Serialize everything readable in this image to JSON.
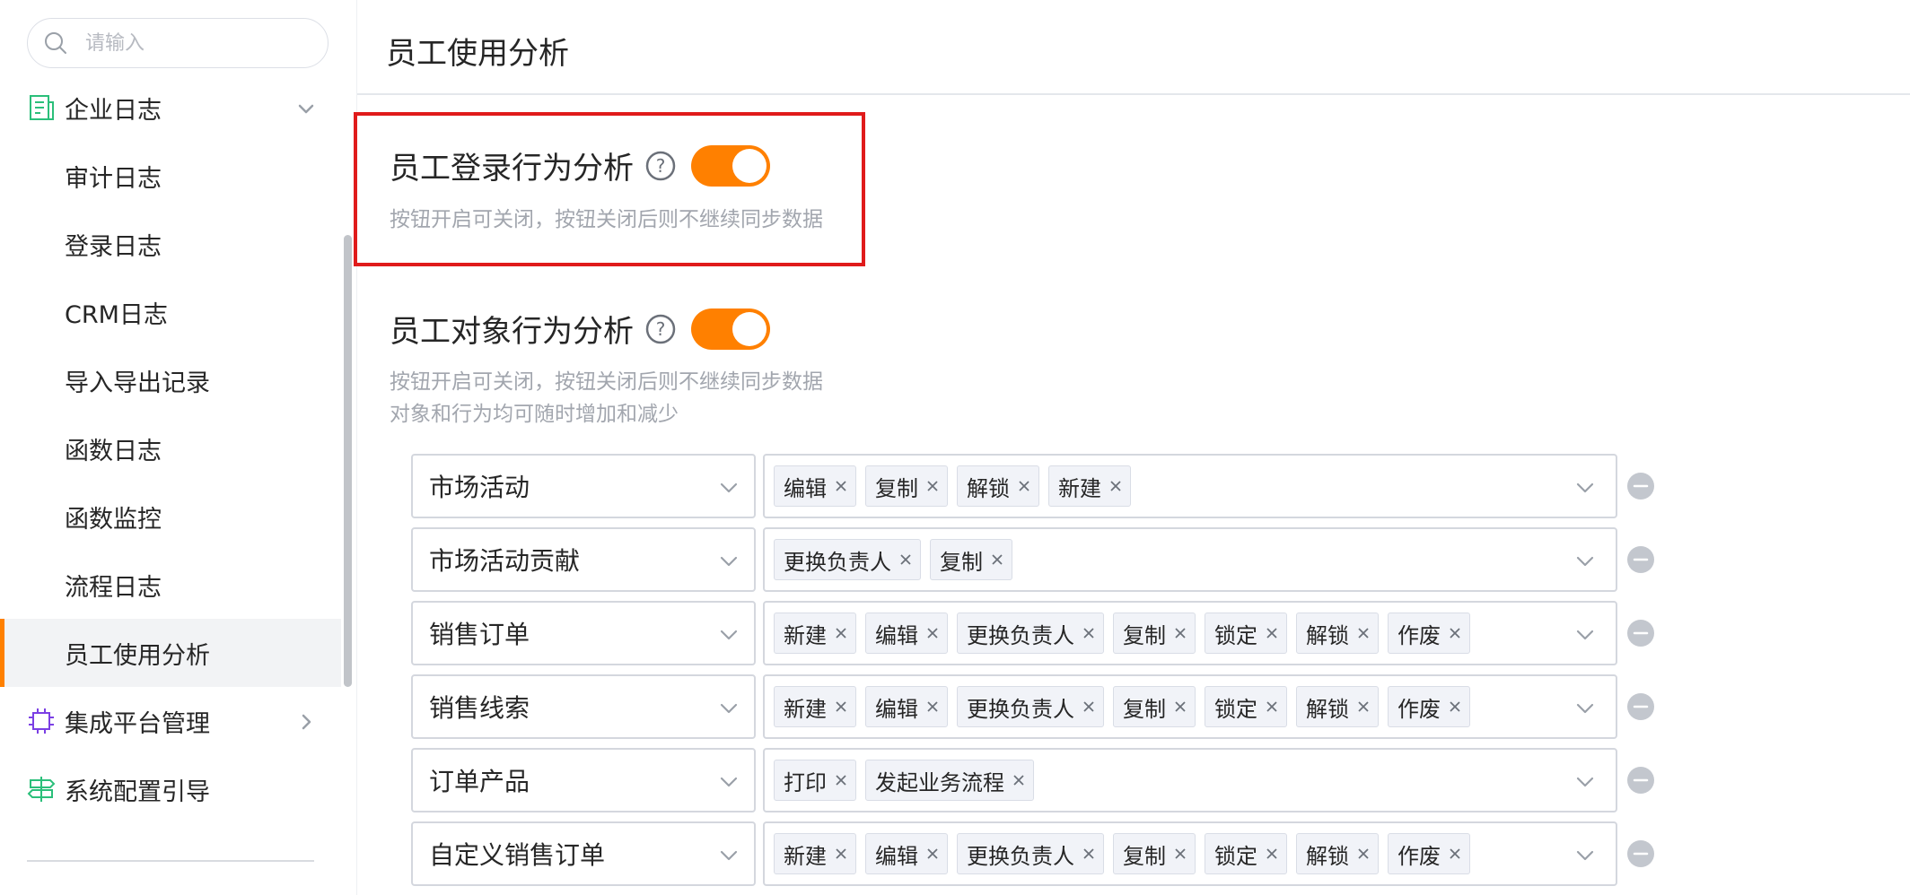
{
  "sidebar": {
    "search_placeholder": "请输入",
    "groups": {
      "enterprise_log": "企业日志",
      "integration": "集成平台管理",
      "config_guide": "系统配置引导"
    },
    "items": [
      {
        "label": "审计日志"
      },
      {
        "label": "登录日志"
      },
      {
        "label": "CRM日志"
      },
      {
        "label": "导入导出记录"
      },
      {
        "label": "函数日志"
      },
      {
        "label": "函数监控"
      },
      {
        "label": "流程日志"
      },
      {
        "label": "员工使用分析"
      }
    ]
  },
  "main": {
    "title": "员工使用分析",
    "login_section": {
      "title": "员工登录行为分析",
      "enabled": true,
      "desc": "按钮开启可关闭，按钮关闭后则不继续同步数据"
    },
    "object_section": {
      "title": "员工对象行为分析",
      "enabled": true,
      "desc1": "按钮开启可关闭，按钮关闭后则不继续同步数据",
      "desc2": "对象和行为均可随时增加和减少"
    },
    "rows": [
      {
        "object": "市场活动",
        "tags": [
          "编辑",
          "复制",
          "解锁",
          "新建"
        ]
      },
      {
        "object": "市场活动贡献",
        "tags": [
          "更换负责人",
          "复制"
        ]
      },
      {
        "object": "销售订单",
        "tags": [
          "新建",
          "编辑",
          "更换负责人",
          "复制",
          "锁定",
          "解锁",
          "作废"
        ]
      },
      {
        "object": "销售线索",
        "tags": [
          "新建",
          "编辑",
          "更换负责人",
          "复制",
          "锁定",
          "解锁",
          "作废"
        ]
      },
      {
        "object": "订单产品",
        "tags": [
          "打印",
          "发起业务流程"
        ]
      },
      {
        "object": "自定义销售订单",
        "tags": [
          "新建",
          "编辑",
          "更换负责人",
          "复制",
          "锁定",
          "解锁",
          "作废"
        ]
      }
    ]
  },
  "colors": {
    "accent": "#ff8000",
    "highlight_border": "#e01b1b",
    "tag_bg": "#f1f3f8",
    "icon_green": "#2bbf7a",
    "icon_purple": "#7b3fe4"
  }
}
